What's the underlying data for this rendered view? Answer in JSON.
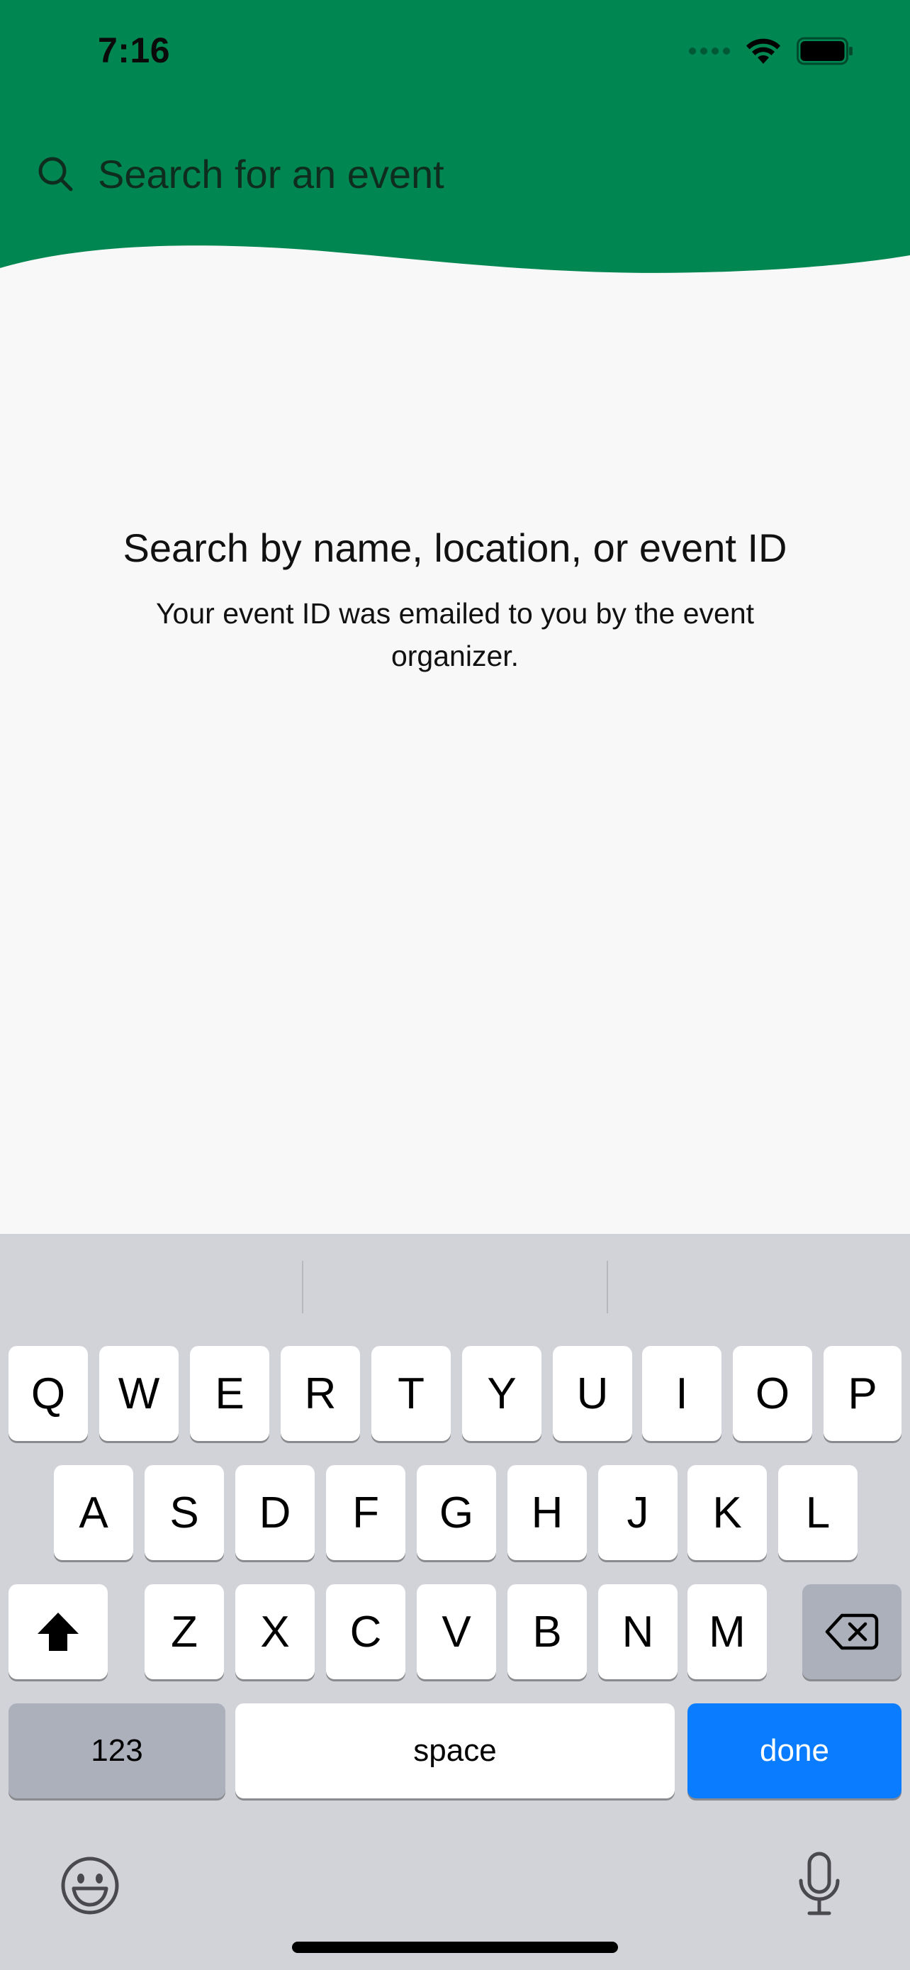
{
  "colors": {
    "header_green": "#008751",
    "page_bg": "#f8f8f8",
    "keyboard_bg": "#d2d3d9",
    "done_blue": "#0a7cff"
  },
  "status_bar": {
    "time": "7:16",
    "icons": [
      "cellular-signal-icon",
      "wifi-icon",
      "battery-icon"
    ]
  },
  "search": {
    "placeholder": "Search for an event",
    "value": "",
    "icon": "search-icon"
  },
  "empty_state": {
    "title": "Search by name, location, or event ID",
    "subtitle": "Your event ID was emailed to you by the event organizer."
  },
  "keyboard": {
    "row1": [
      "Q",
      "W",
      "E",
      "R",
      "T",
      "Y",
      "U",
      "I",
      "O",
      "P"
    ],
    "row2": [
      "A",
      "S",
      "D",
      "F",
      "G",
      "H",
      "J",
      "K",
      "L"
    ],
    "row3": [
      "Z",
      "X",
      "C",
      "V",
      "B",
      "N",
      "M"
    ],
    "numbers_label": "123",
    "space_label": "space",
    "done_label": "done",
    "icons": [
      "shift-icon",
      "backspace-icon",
      "emoji-icon",
      "microphone-icon"
    ]
  }
}
